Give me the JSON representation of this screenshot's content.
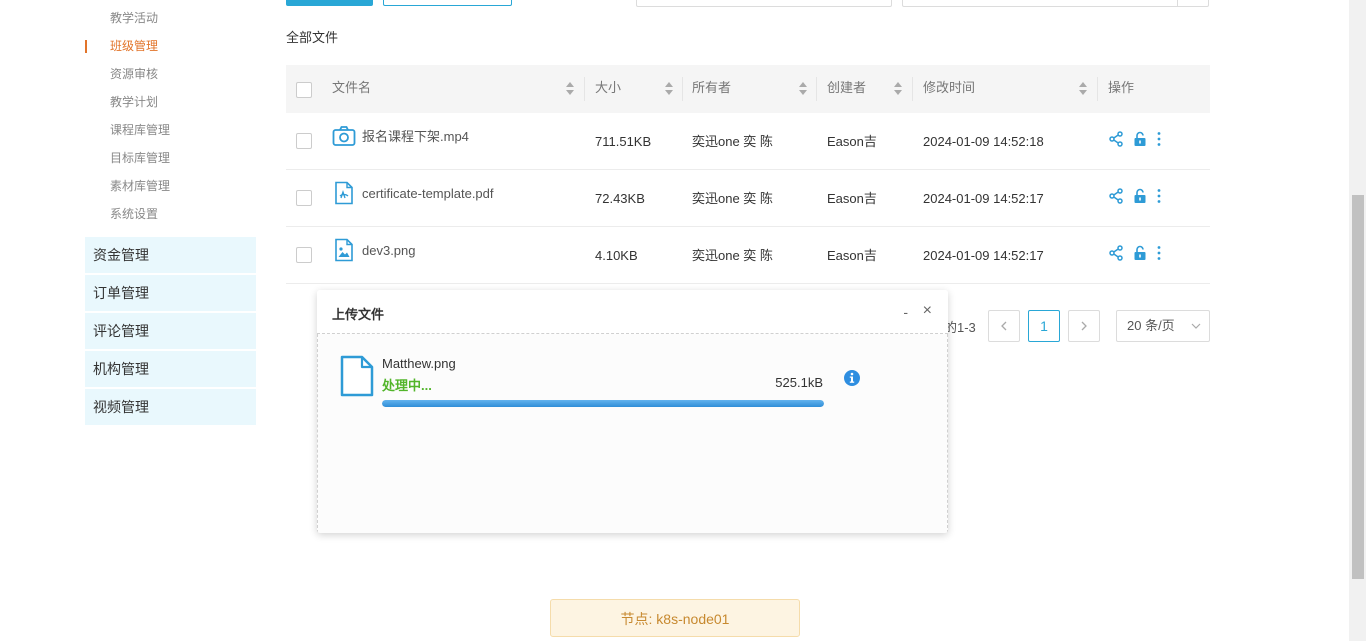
{
  "sidebar": {
    "sub_items": [
      {
        "label": "教学活动",
        "active": false
      },
      {
        "label": "班级管理",
        "active": true
      },
      {
        "label": "资源审核",
        "active": false
      },
      {
        "label": "教学计划",
        "active": false
      },
      {
        "label": "课程库管理",
        "active": false
      },
      {
        "label": "目标库管理",
        "active": false
      },
      {
        "label": "素材库管理",
        "active": false
      },
      {
        "label": "系统设置",
        "active": false
      }
    ],
    "main_items": [
      {
        "label": "资金管理"
      },
      {
        "label": "订单管理"
      },
      {
        "label": "评论管理"
      },
      {
        "label": "机构管理"
      },
      {
        "label": "视频管理"
      }
    ]
  },
  "section_title": "全部文件",
  "table": {
    "headers": {
      "name": "文件名",
      "size": "大小",
      "owner": "所有者",
      "creator": "创建者",
      "modified": "修改时间",
      "actions": "操作"
    },
    "rows": [
      {
        "icon": "camera-icon",
        "name": "报名课程下架.mp4",
        "size": "711.51KB",
        "owner": "奕迅one 奕 陈",
        "creator": "Eason吉",
        "modified": "2024-01-09 14:52:18"
      },
      {
        "icon": "pdf-file-icon",
        "name": "certificate-template.pdf",
        "size": "72.43KB",
        "owner": "奕迅one 奕 陈",
        "creator": "Eason吉",
        "modified": "2024-01-09 14:52:17"
      },
      {
        "icon": "image-file-icon",
        "name": "dev3.png",
        "size": "4.10KB",
        "owner": "奕迅one 奕 陈",
        "creator": "Eason吉",
        "modified": "2024-01-09 14:52:17"
      }
    ]
  },
  "pagination": {
    "range_text": "的1-3",
    "current_page": "1",
    "page_size_label": "20 条/页"
  },
  "upload_dialog": {
    "title": "上传文件",
    "minimize_label": "-",
    "close_label": "×",
    "file_name": "Matthew.png",
    "status": "处理中...",
    "file_size": "525.1kB",
    "progress": 1.0
  },
  "node_banner": "节点: k8s-node01",
  "colors": {
    "accent": "#29a7d6",
    "active_menu": "#e2742a",
    "status_green": "#52b52a",
    "banner_text": "#c7892f"
  }
}
